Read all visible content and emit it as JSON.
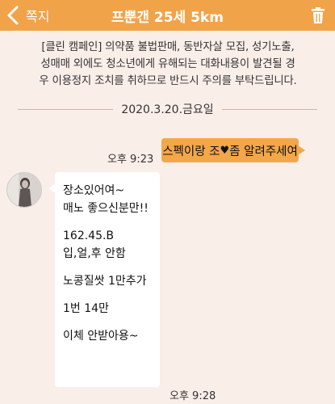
{
  "header": {
    "back_label": "쪽지",
    "title": "프뿐갠 25세 5km",
    "back_icon": "chevron-left-icon",
    "trash_icon": "trash-icon"
  },
  "notice": {
    "line1": "[클린 캠페인] 의약품 불법판매, 동반자살 모집, 성기노출,",
    "line2": "성매매 외에도 청소년에게 유해되는 대화내용이 발견될 경",
    "line3": "우 이용정지 조치를 취하므로 반드시 주의를 부탁드립니다."
  },
  "date_divider": "2020.3.20.금요일",
  "messages": {
    "outgoing": {
      "time": "오후 9:23",
      "text_before": "스펙이랑 조",
      "heart": "♥",
      "text_after": "좀 알려주세여"
    },
    "incoming": {
      "time": "오후 9:28",
      "lines": [
        "장소있어여~",
        "매노 좋으신분만!!",
        "162.45.B",
        "입,얼,후 안함",
        "노콩질쌋 1만추가",
        "1번 14만",
        "이체 안받아용~"
      ]
    }
  },
  "colors": {
    "header": "#f1a34a",
    "background": "#faeee9",
    "outgoing_bubble": "#f4a748",
    "incoming_bubble": "#ffffff"
  }
}
